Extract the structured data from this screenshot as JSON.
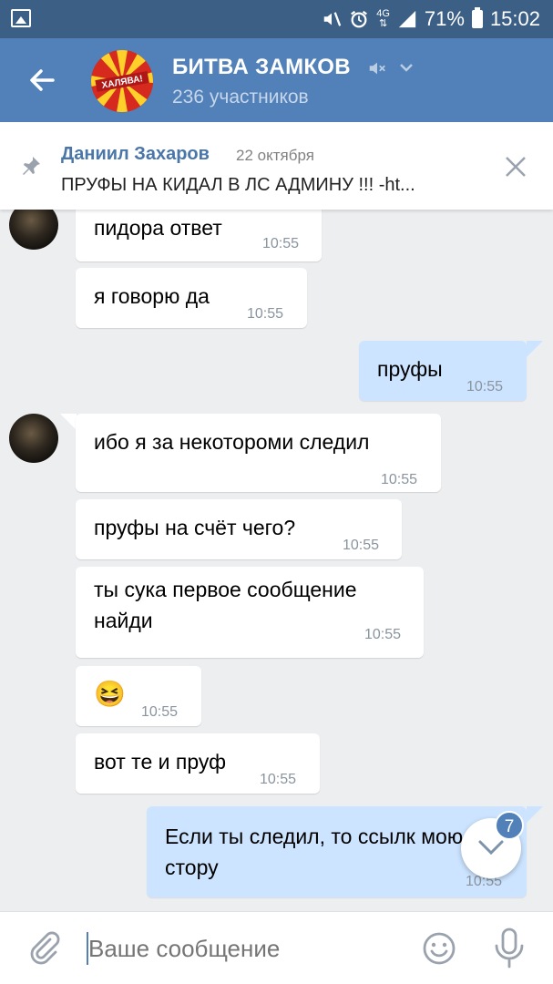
{
  "status": {
    "network": "4G",
    "battery": "71%",
    "time": "15:02"
  },
  "header": {
    "title": "БИТВА ЗАМКОВ",
    "members": "236 участников",
    "logo_text": "ХАЛЯВА!"
  },
  "pinned": {
    "author": "Даниил Захаров",
    "date": "22 октября",
    "text": "ПРУФЫ НА КИДАЛ В ЛС АДМИНУ !!! -ht..."
  },
  "messages": [
    {
      "dir": "in",
      "text": "пидора ответ",
      "time": "10:55"
    },
    {
      "dir": "in",
      "text": "я говорю да",
      "time": "10:55"
    },
    {
      "dir": "out",
      "text": "пруфы",
      "time": "10:55"
    },
    {
      "dir": "in",
      "text": "ибо я за некотороми следил",
      "time": "10:55"
    },
    {
      "dir": "in",
      "text": "пруфы на счёт чего?",
      "time": "10:55"
    },
    {
      "dir": "in",
      "text": "ты сука первое сообщение найди",
      "time": "10:55"
    },
    {
      "dir": "in",
      "text": "😆",
      "time": "10:55"
    },
    {
      "dir": "in",
      "text": "вот те и пруф",
      "time": "10:55"
    },
    {
      "dir": "out",
      "text": "Если ты следил, то ссылк мою стору",
      "time": "10:55"
    }
  ],
  "scroll_badge": "7",
  "composer": {
    "placeholder": "Ваше сообщение"
  },
  "colors": {
    "header": "#5181b8",
    "statusbar": "#3c5f86",
    "outgoing": "#cce4ff",
    "background": "#edeef0",
    "link": "#4a76a8"
  }
}
